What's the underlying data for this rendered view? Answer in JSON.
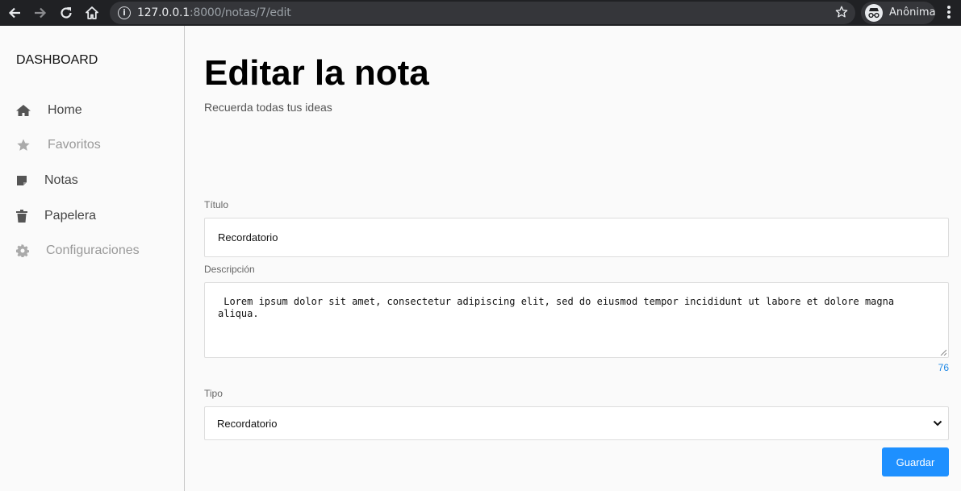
{
  "browser": {
    "url_host": "127.0.0.1",
    "url_rest": ":8000/notas/7/edit",
    "profile_label": "Anônima"
  },
  "sidebar": {
    "brand": "DASHBOARD",
    "items": [
      {
        "label": "Home",
        "icon": "home-icon"
      },
      {
        "label": "Favoritos",
        "icon": "star-icon"
      },
      {
        "label": "Notas",
        "icon": "note-icon"
      },
      {
        "label": "Papelera",
        "icon": "trash-icon"
      },
      {
        "label": "Configuraciones",
        "icon": "gear-icon"
      }
    ]
  },
  "main": {
    "title": "Editar la nota",
    "subtitle": "Recuerda todas tus ideas",
    "titulo_label": "Título",
    "titulo_value": "Recordatorio",
    "descripcion_label": "Descripción",
    "descripcion_value": " Lorem ipsum dolor sit amet, consectetur adipiscing elit, sed do eiusmod tempor incididunt ut labore et dolore magna aliqua.",
    "char_count": "76",
    "tipo_label": "Tipo",
    "tipo_value": "Recordatorio",
    "save_label": "Guardar"
  },
  "colors": {
    "accent": "#1e90ff",
    "counter": "#1e88e5",
    "chrome_bg": "#202124"
  }
}
